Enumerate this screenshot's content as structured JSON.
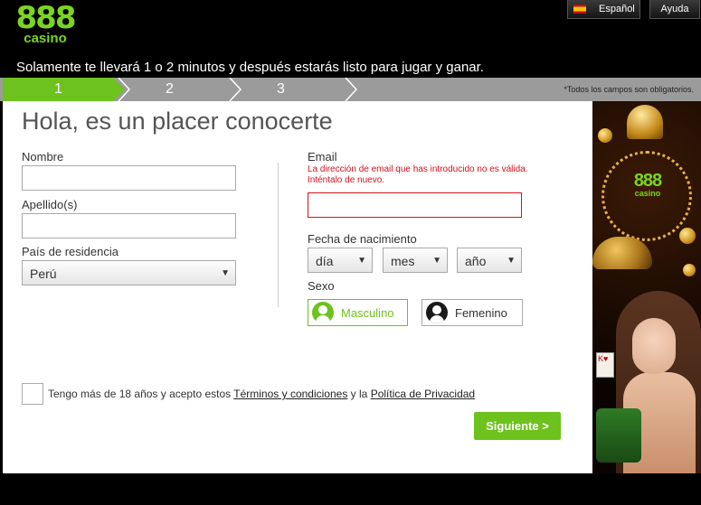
{
  "header": {
    "logo_number": "888",
    "logo_word": "casino",
    "tagline": "Solamente te llevará 1 o 2 minutos y después estarás listo para jugar y ganar.",
    "language_label": "Español",
    "help_label": "Ayuda"
  },
  "steps": {
    "items": [
      "1",
      "2",
      "3"
    ],
    "current": 1,
    "note": "*Todos los campos son obligatorios."
  },
  "form": {
    "title": "Hola, es un placer conocerte",
    "first_name": {
      "label": "Nombre",
      "value": ""
    },
    "last_name": {
      "label": "Apellido(s)",
      "value": ""
    },
    "country": {
      "label": "País de residencia",
      "value": "Perú"
    },
    "email": {
      "label": "Email",
      "value": "",
      "error": "La dirección de email que has introducido no es válida. Inténtalo de nuevo."
    },
    "birthdate": {
      "label": "Fecha de nacimiento",
      "day": "día",
      "month": "mes",
      "year": "año"
    },
    "gender": {
      "label": "Sexo",
      "male": "Masculino",
      "female": "Femenino",
      "selected": "Masculino"
    },
    "terms": {
      "prefix": "Tengo más de 18 años y acepto estos",
      "terms_link": "Términos y condiciones",
      "middle": "y la",
      "privacy_link": "Política de Privacidad",
      "checked": false
    },
    "next_button": "Siguiente >"
  },
  "banner": {
    "logo_number": "888",
    "logo_word": "casino",
    "card_text": "K♥"
  },
  "colors": {
    "brand_green": "#6ec21d",
    "error_red": "#d2121a",
    "step_bar_gray": "#9b9b9b"
  }
}
